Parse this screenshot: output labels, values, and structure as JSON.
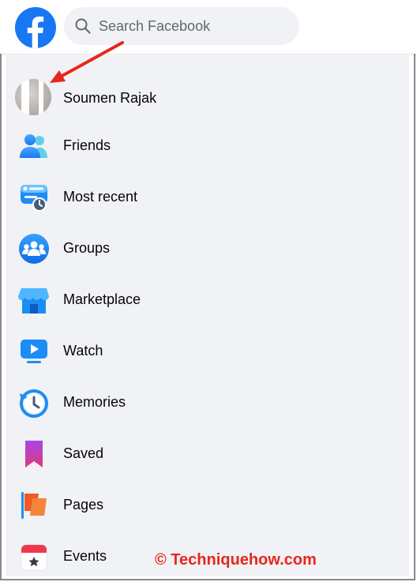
{
  "header": {
    "search_placeholder": "Search Facebook",
    "brand_color": "#1877f2"
  },
  "profile": {
    "name": "Soumen Rajak"
  },
  "menu": [
    {
      "label": "Friends",
      "icon": "friends-icon"
    },
    {
      "label": "Most recent",
      "icon": "most-recent-icon"
    },
    {
      "label": "Groups",
      "icon": "groups-icon"
    },
    {
      "label": "Marketplace",
      "icon": "marketplace-icon"
    },
    {
      "label": "Watch",
      "icon": "watch-icon"
    },
    {
      "label": "Memories",
      "icon": "memories-icon"
    },
    {
      "label": "Saved",
      "icon": "saved-icon"
    },
    {
      "label": "Pages",
      "icon": "pages-icon"
    },
    {
      "label": "Events",
      "icon": "events-icon"
    }
  ],
  "watermark": "© Techniquehow.com",
  "annotation_color": "#e8261c"
}
